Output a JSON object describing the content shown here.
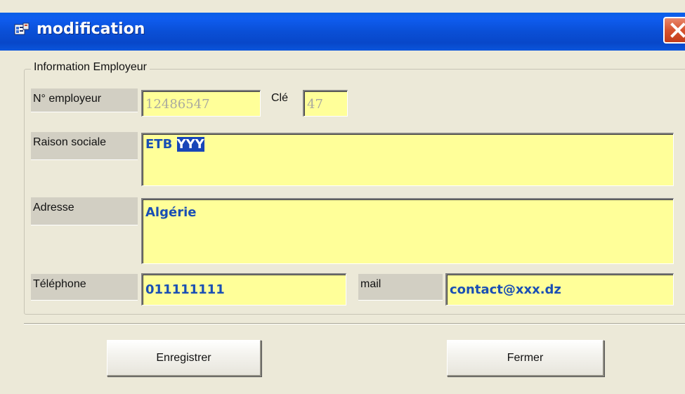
{
  "window": {
    "title": "modification"
  },
  "group": {
    "legend": "Information Employeur"
  },
  "fields": {
    "employer_no": {
      "label": "N° employeur",
      "value": "12486547"
    },
    "key": {
      "label": "Clé",
      "value": "47"
    },
    "company_name": {
      "label": "Raison sociale",
      "value_prefix": "ETB ",
      "value_selected": "YYY"
    },
    "address": {
      "label": "Adresse",
      "value": "Algérie"
    },
    "phone": {
      "label": "Téléphone",
      "value": "011111111"
    },
    "mail": {
      "label": "mail",
      "value": "contact@xxx.dz"
    }
  },
  "buttons": {
    "save_label": "Enregistrer",
    "close_label": "Fermer"
  },
  "colors": {
    "titlebar": "#0a4fd6",
    "field_bg": "#ffff99",
    "field_text": "#1a4fb4",
    "selection": "#1846b8",
    "close_button": "#d6532f"
  },
  "icons": {
    "title": "app-window-icon",
    "close": "close-icon"
  }
}
